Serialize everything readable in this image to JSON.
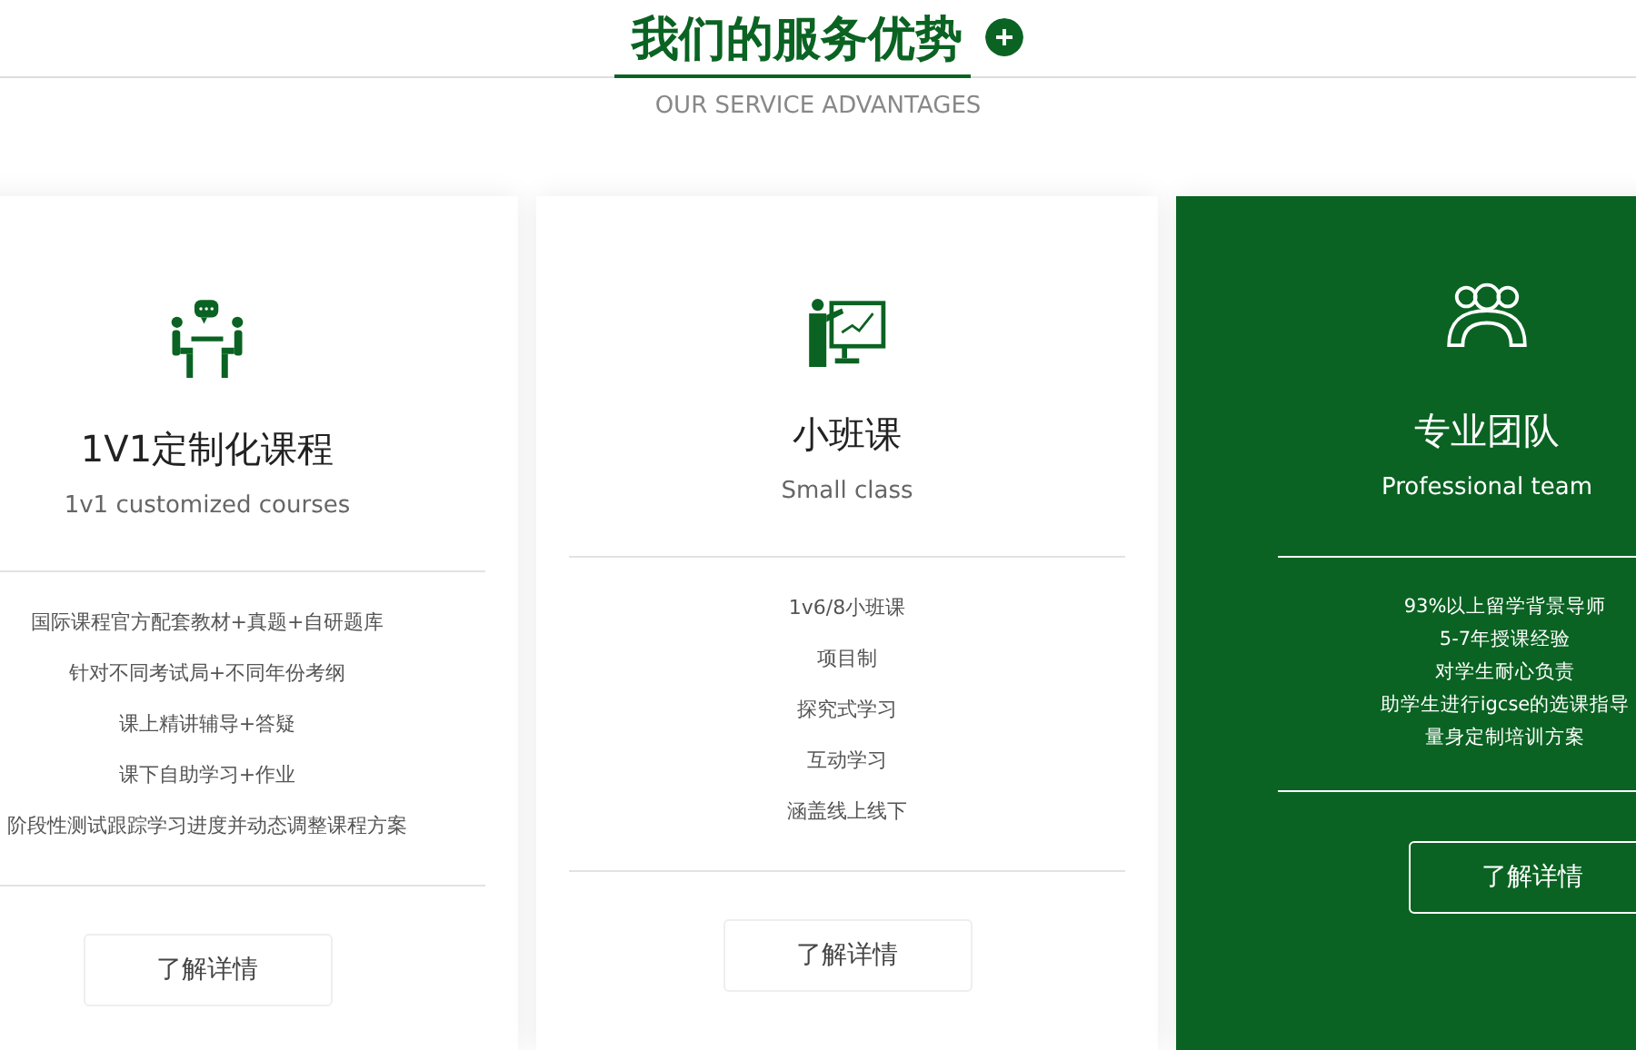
{
  "header": {
    "title": "我们的服务优势",
    "subtitle": "OUR SERVICE ADVANTAGES"
  },
  "cards": [
    {
      "kind": "tutoring",
      "selected": false,
      "title": "1V1定制化课程",
      "subtitle": "1v1 customized courses",
      "features": [
        "国际课程官方配套教材+真题+自研题库",
        "针对不同考试局+不同年份考纲",
        "课上精讲辅导+答疑",
        "课下自助学习+作业",
        "阶段性测试跟踪学习进度并动态调整课程方案"
      ],
      "button": "了解详情"
    },
    {
      "kind": "presentation",
      "selected": false,
      "title": "小班课",
      "subtitle": "Small class",
      "features": [
        "1v6/8小班课",
        "项目制",
        "探究式学习",
        "互动学习",
        "涵盖线上线下"
      ],
      "button": "了解详情"
    },
    {
      "kind": "team",
      "selected": true,
      "title": "专业团队",
      "subtitle": "Professional team",
      "features": [
        "93%以上留学背景导师",
        "5-7年授课经验",
        "对学生耐心负责",
        "助学生进行igcse的选课指导",
        "量身定制培训方案"
      ],
      "button": "了解详情"
    }
  ]
}
